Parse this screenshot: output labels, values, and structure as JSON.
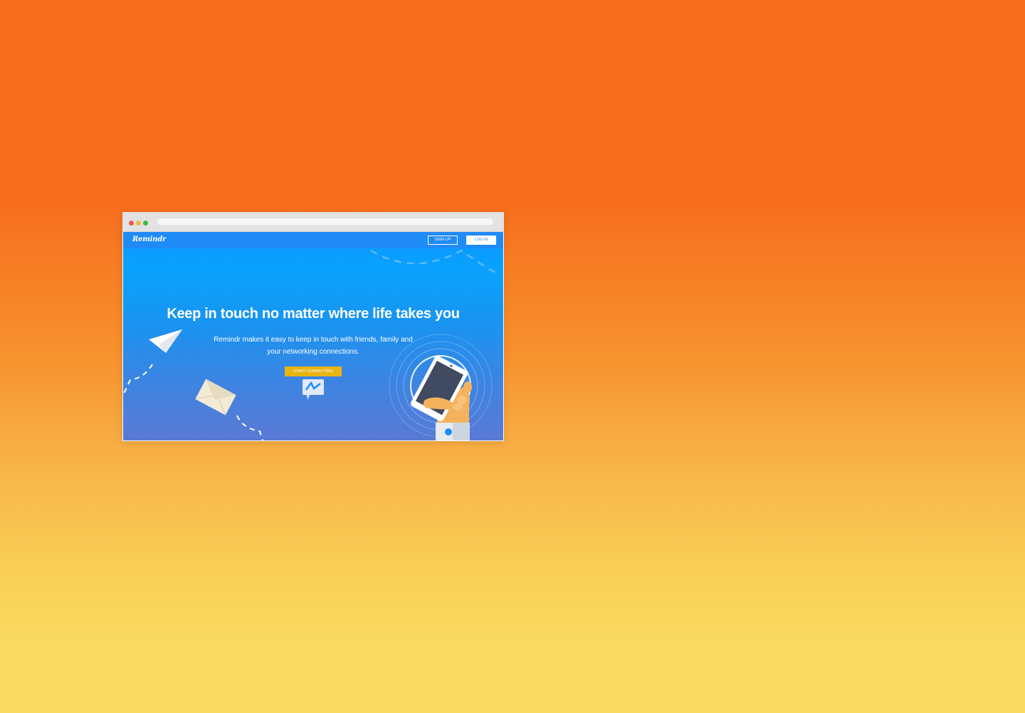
{
  "brand": {
    "name": "Remindr"
  },
  "nav": {
    "signup_label": "SIGN UP",
    "login_label": "LOG IN"
  },
  "hero": {
    "headline": "Keep in touch no matter where life takes you",
    "subtitle": "Remindr makes it easy to keep in touch with friends, family and your networking connections.",
    "cta_label": "START CONNECTING"
  },
  "icons": {
    "window_controls": [
      "close-dot",
      "minimize-dot",
      "maximize-dot"
    ],
    "illustrations": [
      "paper-plane-icon",
      "envelope-icon",
      "chat-bubble-icon",
      "phone-in-hand-icon"
    ]
  },
  "colors": {
    "background_top": "#f76d1d",
    "background_bottom": "#fadc62",
    "hero_top": "#0aa2fc",
    "hero_bottom": "#5a7ad4",
    "cta": "#e8b413",
    "nav": "#1f8bf7"
  }
}
